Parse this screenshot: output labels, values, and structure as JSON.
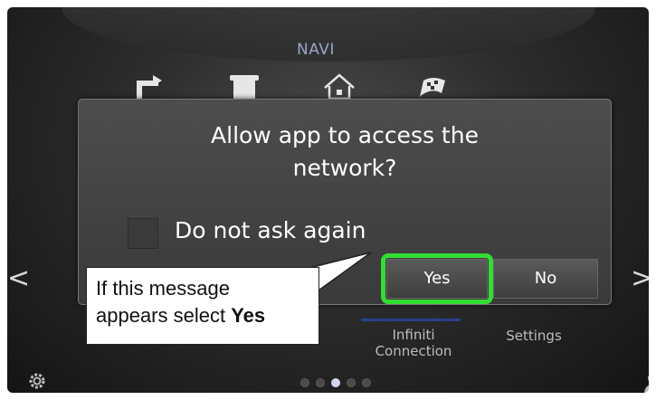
{
  "header": {
    "title": "NAVI"
  },
  "menu_icons": [
    "back-icon",
    "phone-icon",
    "home-icon",
    "destination-flag-icon"
  ],
  "dialog": {
    "title": "Allow app to access the network?",
    "checkbox_label": "Do not ask again",
    "checkbox_checked": false,
    "yes_label": "Yes",
    "no_label": "No",
    "highlight_color": "#33dd33"
  },
  "nav": {
    "left_arrow": "<",
    "right_arrow": ">"
  },
  "bottom_menu": {
    "infiniti_connection": "Infiniti\nConnection",
    "settings": "Settings"
  },
  "page_indicator": {
    "total": 5,
    "active_index": 2
  },
  "callout": {
    "line1": "If this message",
    "line2_prefix": "appears select ",
    "line2_bold": "Yes"
  }
}
